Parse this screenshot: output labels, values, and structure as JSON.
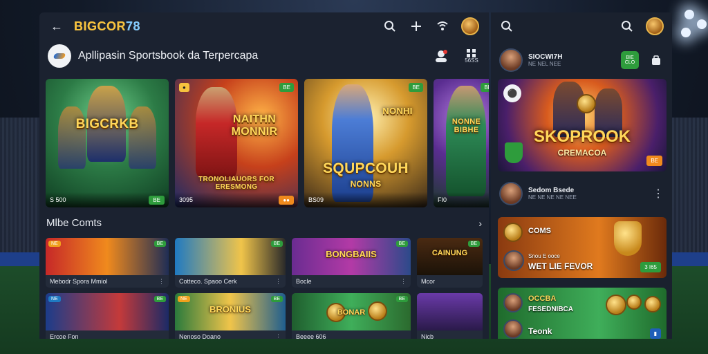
{
  "app": {
    "brand_main": "BIGCOR",
    "brand_num": "78",
    "subtitle": "Apllipasin Sportsbook da Terpercapa"
  },
  "icons": {
    "back": "arrow-left-icon",
    "search": "search-icon",
    "sort": "sort-icon",
    "wifi": "wifi-icon",
    "profile": "avatar"
  },
  "sub_icons": {
    "chat_label": "",
    "grid_label": "56SS"
  },
  "big_cards": [
    {
      "title": "BIGCRKB",
      "foot": "S 500",
      "badge": "",
      "btn": "BE",
      "btn_color": "green"
    },
    {
      "title": "NAITHN MONNIR",
      "foot": "3095",
      "badge": "",
      "btn": "",
      "btn_color": "orange",
      "bottom_title": "TRONOLIAUORS FOR ERESMONG"
    },
    {
      "title": "SQUPCOUH",
      "foot": "BS09",
      "badge": "",
      "btn": "",
      "btn_color": "green",
      "top_title": "NONHI",
      "sub_title": "NONNS"
    },
    {
      "title": "NONNE BIBHE",
      "foot": "FI0",
      "badge": "",
      "btn": "",
      "btn_color": "green"
    }
  ],
  "section": {
    "title": "Mlbe Comts"
  },
  "small_cards": [
    {
      "caption": "Mebodr Spora Mmiol",
      "title": ""
    },
    {
      "caption": "Cotteco. Spaoo Cerk",
      "title": ""
    },
    {
      "caption": "Bocle",
      "title": "BONGBAIIS"
    },
    {
      "caption": "Mcor",
      "title": "CAINUNG"
    },
    {
      "caption": "Ercoe Fon",
      "title": ""
    },
    {
      "caption": "Nenoso Doano",
      "title": "BRONIUS"
    },
    {
      "caption": "Beeee 606",
      "title": "BONAR"
    },
    {
      "caption": "Nicb",
      "title": ""
    }
  ],
  "sidebar": {
    "top_user": {
      "name": "SIOCWI7H",
      "sub": "NE NEL NEE"
    },
    "pill": "BIE CLO",
    "feature": {
      "title": "SKOPROOK",
      "subtitle": "CREMACOA"
    },
    "row2": {
      "name": "Sedom Bsede",
      "sub": "NE NE NE NE NEE"
    },
    "item1": {
      "label": "COMS",
      "label2": "WET LIE FEVOR",
      "sub": "Snou E ooce",
      "btn": "3 I65"
    },
    "item2": {
      "label": "OCCBA",
      "label2": "FESEDNIBCA",
      "label3": "Teonk"
    }
  },
  "colors": {
    "accent_green": "#2e9c3c",
    "accent_orange": "#f08a1d",
    "gold": "#ffd75a",
    "panel": "#1b2230"
  }
}
